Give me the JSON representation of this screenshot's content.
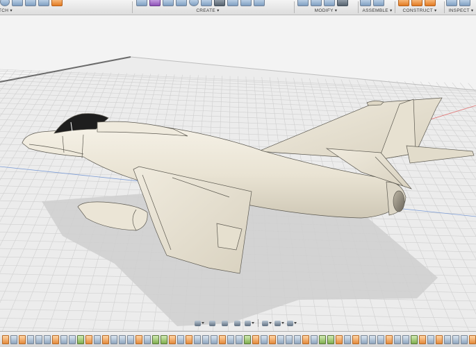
{
  "toolbar": {
    "groups": [
      {
        "key": "sketch",
        "label": "SKETCH ▾"
      },
      {
        "key": "create",
        "label": "CREATE ▾"
      },
      {
        "key": "modify",
        "label": "MODIFY ▾"
      },
      {
        "key": "assemble",
        "label": "ASSEMBLE ▾"
      },
      {
        "key": "construct",
        "label": "CONSTRUCT ▾"
      },
      {
        "key": "inspect",
        "label": "INSPECT ▾"
      }
    ]
  },
  "navbar": {
    "tools": [
      "orbit",
      "pan",
      "zoom",
      "fit",
      "display-settings",
      "grid-and-snaps",
      "viewports"
    ]
  },
  "timeline": {
    "features": [
      "sketch",
      "extrude",
      "sketch",
      "extrude",
      "loft",
      "fillet",
      "sketch",
      "extrude",
      "revolve",
      "mirror",
      "sketch",
      "loft",
      "sketch",
      "extrude",
      "fillet",
      "chamfer",
      "sketch",
      "loft",
      "mirror",
      "combine"
    ]
  },
  "viewport": {
    "grid": true,
    "background": "#f3f3f3",
    "model_color": "#ebe5d6",
    "canopy_color": "#1e1e1e"
  }
}
